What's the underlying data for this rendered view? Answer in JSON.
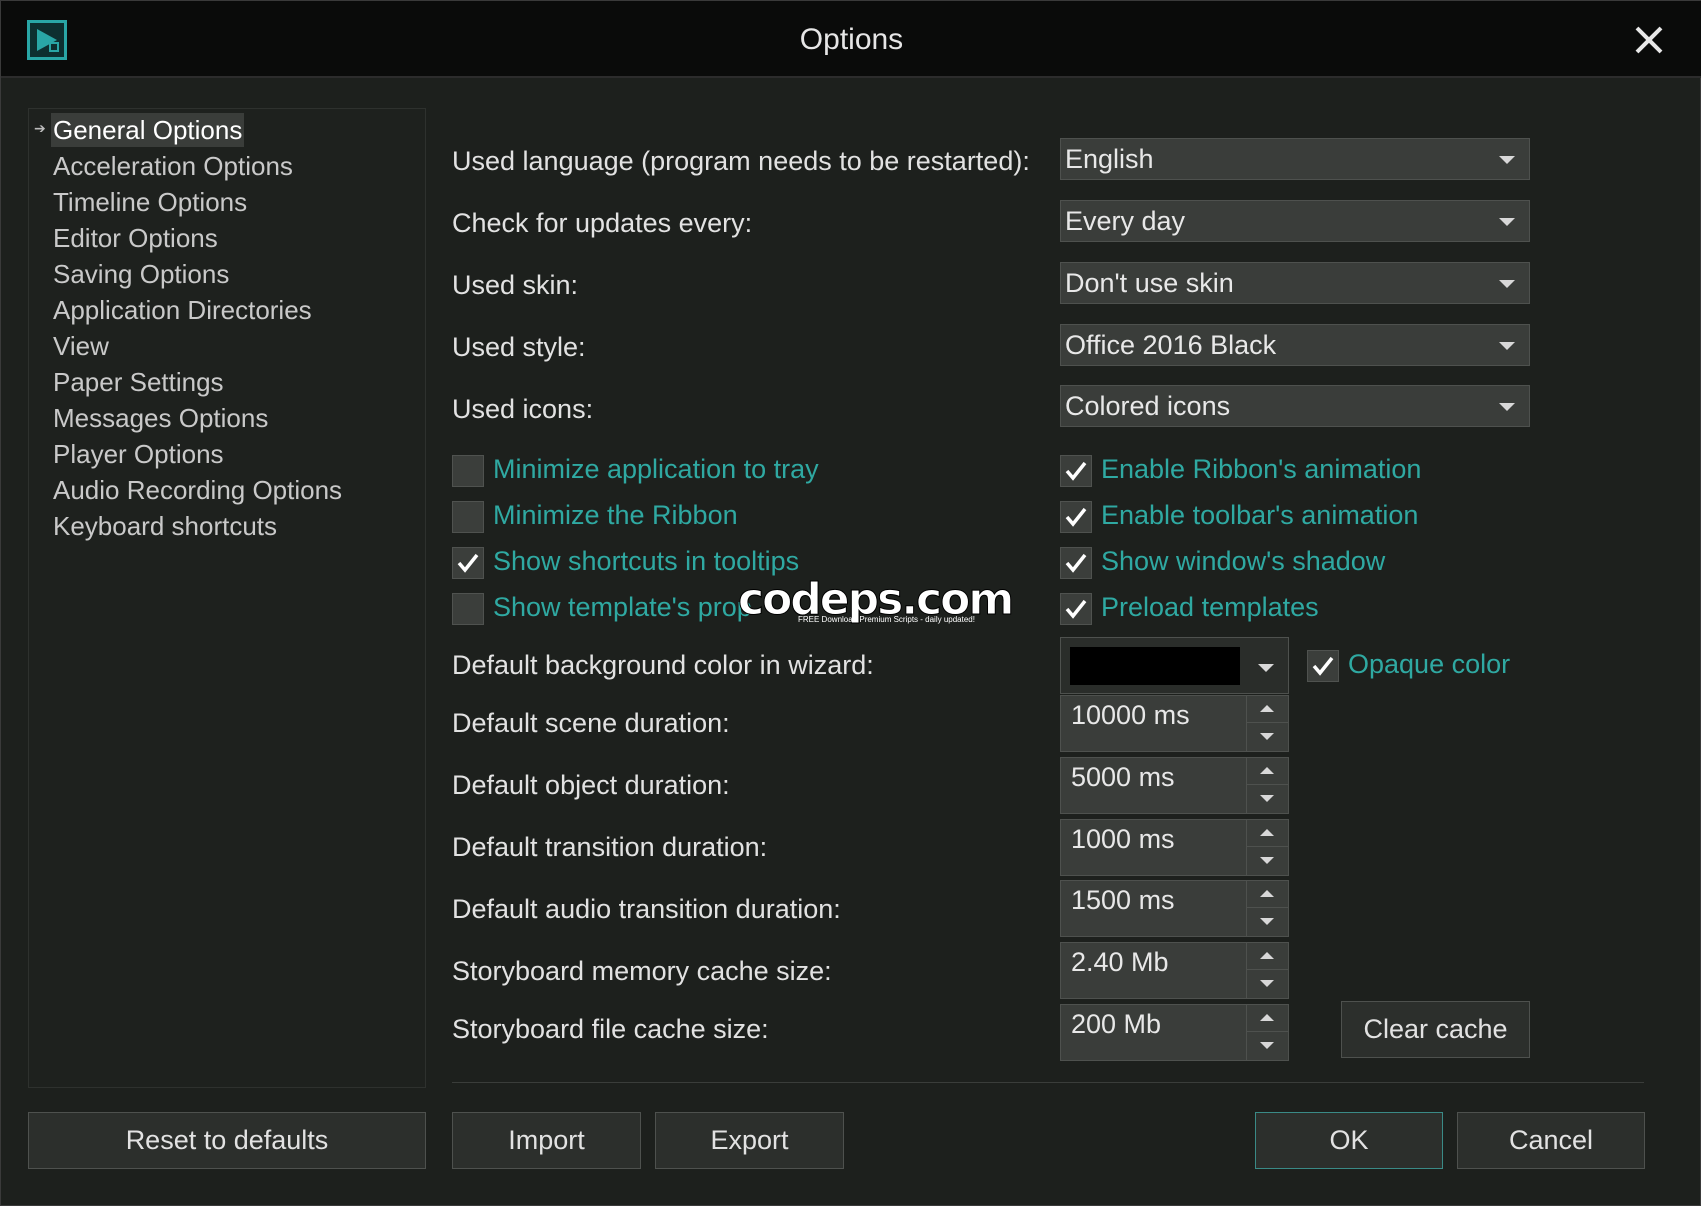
{
  "window": {
    "title": "Options",
    "logo_icon": "app-logo-icon",
    "close_icon": "close-icon"
  },
  "nav": {
    "items": [
      {
        "label": "General Options",
        "selected": true
      },
      {
        "label": "Acceleration Options",
        "selected": false
      },
      {
        "label": "Timeline Options",
        "selected": false
      },
      {
        "label": "Editor Options",
        "selected": false
      },
      {
        "label": "Saving Options",
        "selected": false
      },
      {
        "label": "Application Directories",
        "selected": false
      },
      {
        "label": "View",
        "selected": false
      },
      {
        "label": "Paper Settings",
        "selected": false
      },
      {
        "label": "Messages Options",
        "selected": false
      },
      {
        "label": "Player Options",
        "selected": false
      },
      {
        "label": "Audio Recording Options",
        "selected": false
      },
      {
        "label": "Keyboard shortcuts",
        "selected": false
      }
    ]
  },
  "general": {
    "language_label": "Used language (program needs to be restarted):",
    "language_value": "English",
    "updates_label": "Check for updates every:",
    "updates_value": "Every day",
    "skin_label": "Used skin:",
    "skin_value": "Don't use skin",
    "style_label": "Used style:",
    "style_value": "Office 2016 Black",
    "icons_label": "Used icons:",
    "icons_value": "Colored icons",
    "checkboxes_left": [
      {
        "label": "Minimize application to tray",
        "checked": false
      },
      {
        "label": "Minimize the Ribbon",
        "checked": false
      },
      {
        "label": "Show shortcuts in tooltips",
        "checked": true
      },
      {
        "label": "Show template's prop",
        "checked": false
      }
    ],
    "checkboxes_right": [
      {
        "label": "Enable Ribbon's animation",
        "checked": true
      },
      {
        "label": "Enable toolbar's animation",
        "checked": true
      },
      {
        "label": "Show window's shadow",
        "checked": true
      },
      {
        "label": "Preload templates",
        "checked": true
      }
    ],
    "bg_color_label": "Default background color in wizard:",
    "bg_color_value": "#000000",
    "opaque_label": "Opaque color",
    "opaque_checked": true,
    "scene_label": "Default scene duration:",
    "scene_value": "10000 ms",
    "object_label": "Default object duration:",
    "object_value": "5000 ms",
    "transition_label": "Default transition duration:",
    "transition_value": "1000 ms",
    "audio_transition_label": "Default audio transition duration:",
    "audio_transition_value": "1500 ms",
    "memory_cache_label": "Storyboard memory cache size:",
    "memory_cache_value": "2.40 Mb",
    "file_cache_label": "Storyboard file cache size:",
    "file_cache_value": "200 Mb",
    "clear_cache_label": "Clear cache"
  },
  "footer": {
    "reset_label": "Reset to defaults",
    "import_label": "Import",
    "export_label": "Export",
    "ok_label": "OK",
    "cancel_label": "Cancel"
  },
  "watermark": {
    "main": "codeps.com",
    "sub": "FREE Download Premium Scripts - daily updated!"
  },
  "colors": {
    "accent": "#2fa9a2",
    "background": "#1d201d",
    "titlebar": "#0a0b0a"
  }
}
